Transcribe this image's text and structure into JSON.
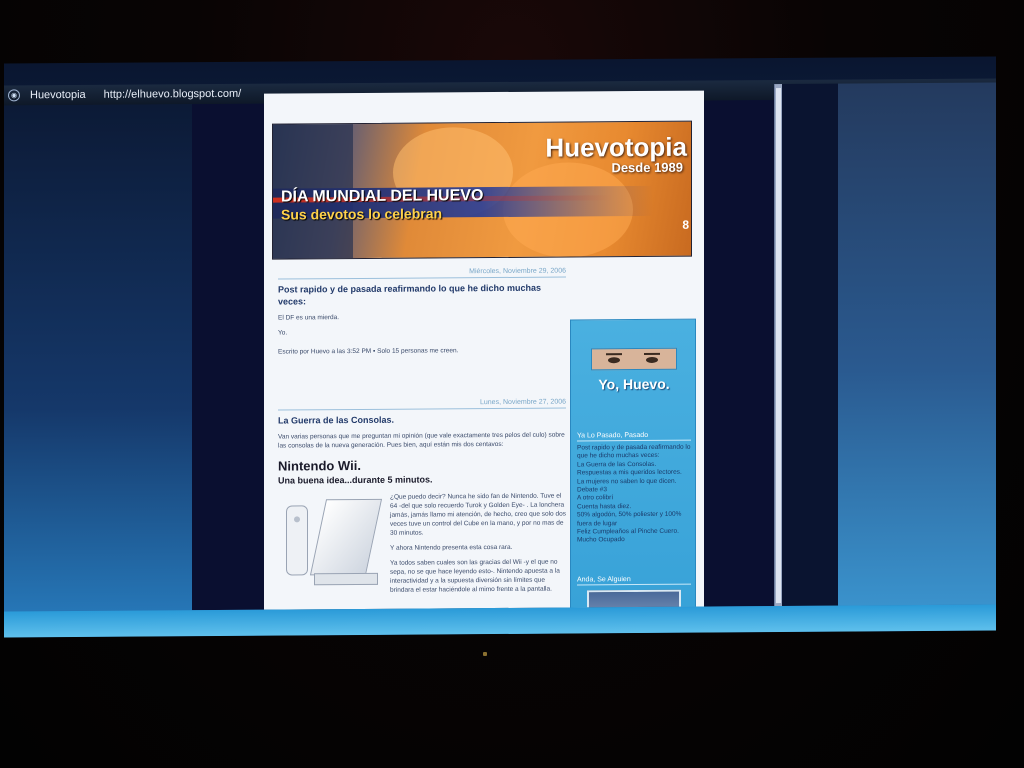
{
  "window": {
    "title": "Huevotopia",
    "url": "http://elhuevo.blogspot.com/",
    "icon": "browser-icon"
  },
  "header": {
    "title": "Huevotopia",
    "subtitle": "Desde 1989",
    "news_line1": "DÍA MUNDIAL DEL HUEVO",
    "news_line2": "Sus devotos lo celebran",
    "corner_number": "8"
  },
  "posts": [
    {
      "date": "Miércoles, Noviembre 29, 2006",
      "title": "Post rapido y de pasada reafirmando lo que he dicho muchas veces:",
      "body": [
        "El DF es una mierda.",
        "Yo."
      ],
      "footer": "Escrito por Huevo a las 3:52 PM ▪ Solo 15 personas me creen."
    },
    {
      "date": "Lunes, Noviembre 27, 2006",
      "title": "La Guerra de las Consolas.",
      "intro": "Van varias personas que me preguntan mi opinión (que vale exactamente tres pelos del culo) sobre las consolas de la nueva generación. Pues bien, aquí están mis dos centavos:",
      "heading": "Nintendo Wii.",
      "subheading": "Una buena idea...durante 5 minutos.",
      "paragraphs": [
        "¿Que puedo decir? Nunca he sido fan de Nintendo. Tuve el 64 -del que solo recuerdo Turok y Golden Eye- . La lonchera jamás, jamás llamo mi atención, de hecho, creo que solo dos veces tuve un control del Cube en la mano, y por no mas de 30 minutos.",
        "Y ahora Nintendo presenta esta cosa rara.",
        "Ya todos saben cuales son las gracias del Wii -y el que no sepa, no se que hace leyendo esto-. Nintendo apuesta a la interactividad y a la supuesta diversión sin límites que brindara el estar haciéndole al mimo frente a la pantalla."
      ]
    }
  ],
  "sidebar": {
    "avatar_caption": "Yo, Huevo.",
    "recent_heading": "Ya Lo Pasado, Pasado",
    "recent_items": [
      "Post rapido y de pasada reafirmando lo que he dicho muchas veces:",
      "La Guerra de las Consolas.",
      "Respuestas a mis queridos lectores.",
      "La mujeres no saben lo que dicen.",
      "Debate #3",
      "A otro colibrí",
      "Cuenta hasta diez.",
      "50% algodón, 50% poliester y 100% fuera de lugar",
      "Feliz Cumpleaños al Pinche Cuero.",
      "Mucho Ocupado"
    ],
    "friends_heading": "Anda, Se Alguien"
  }
}
